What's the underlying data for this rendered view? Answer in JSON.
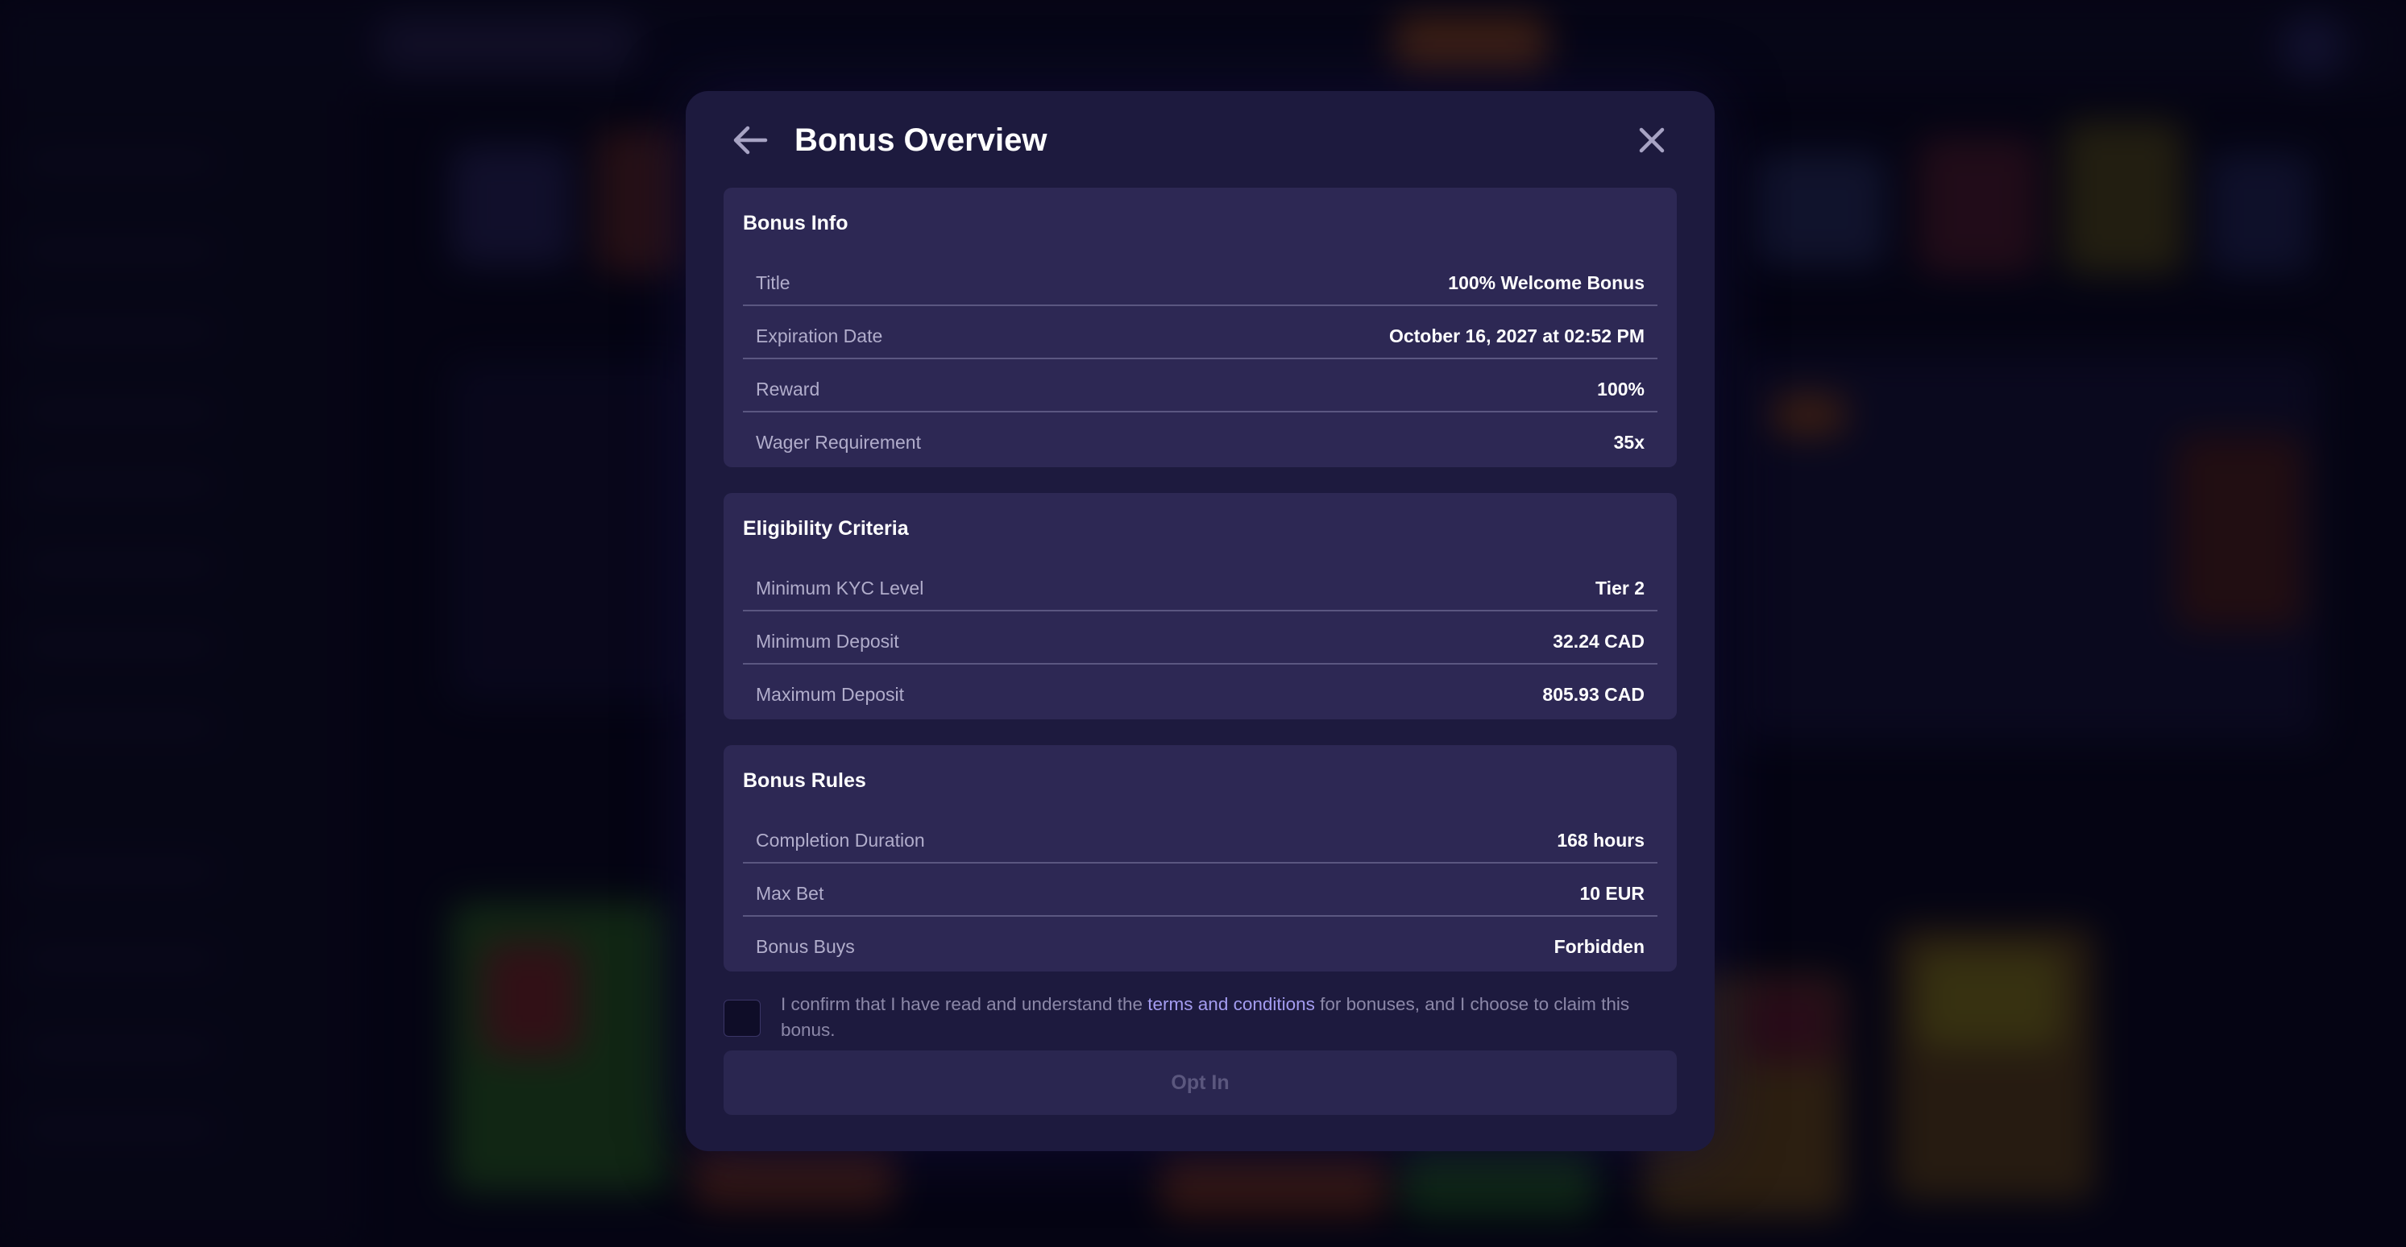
{
  "modal": {
    "title": "Bonus Overview",
    "icons": {
      "back": "arrow-left-icon",
      "close": "close-icon"
    },
    "sections": [
      {
        "title": "Bonus Info",
        "rows": [
          {
            "label": "Title",
            "value": "100% Welcome Bonus"
          },
          {
            "label": "Expiration Date",
            "value": "October 16, 2027 at 02:52 PM"
          },
          {
            "label": "Reward",
            "value": "100%"
          },
          {
            "label": "Wager Requirement",
            "value": "35x"
          }
        ]
      },
      {
        "title": "Eligibility Criteria",
        "rows": [
          {
            "label": "Minimum KYC Level",
            "value": "Tier 2"
          },
          {
            "label": "Minimum Deposit",
            "value": "32.24 CAD"
          },
          {
            "label": "Maximum Deposit",
            "value": "805.93 CAD"
          }
        ]
      },
      {
        "title": "Bonus Rules",
        "rows": [
          {
            "label": "Completion Duration",
            "value": "168 hours"
          },
          {
            "label": "Max Bet",
            "value": "10 EUR"
          },
          {
            "label": "Bonus Buys",
            "value": "Forbidden"
          }
        ]
      }
    ],
    "consent": {
      "checked": false,
      "text_before": "I confirm that I have read and understand the ",
      "link_text": "terms and conditions",
      "text_after": " for bonuses, and I choose to claim this bonus."
    },
    "opt_in_label": "Opt In"
  },
  "colors": {
    "modal_bg": "#1d1a3e",
    "section_bg": "#2d2854",
    "link": "#a49cf0",
    "disabled_button_text": "#5b577e"
  }
}
